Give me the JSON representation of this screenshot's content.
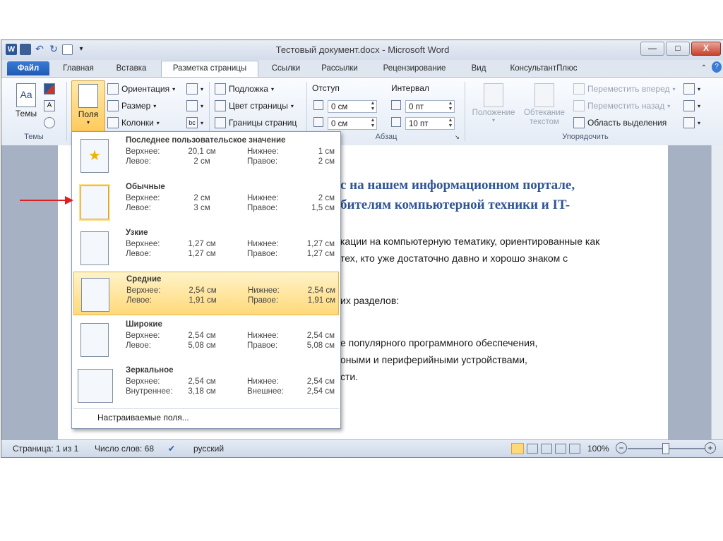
{
  "window": {
    "title": "Тестовый документ.docx - Microsoft Word",
    "app_icon": "W",
    "controls": {
      "minimize": "—",
      "maximize": "□",
      "close": "X"
    }
  },
  "tabs": [
    {
      "label": "Файл"
    },
    {
      "label": "Главная"
    },
    {
      "label": "Вставка"
    },
    {
      "label": "Разметка страницы"
    },
    {
      "label": "Ссылки"
    },
    {
      "label": "Рассылки"
    },
    {
      "label": "Рецензирование"
    },
    {
      "label": "Вид"
    },
    {
      "label": "КонсультантПлюс"
    }
  ],
  "ribbon": {
    "themes": {
      "label": "Темы",
      "group": "Темы"
    },
    "margins": {
      "label": "Поля"
    },
    "page_setup": {
      "orientation": "Ориентация",
      "size": "Размер",
      "columns": "Колонки"
    },
    "background": {
      "watermark": "Подложка",
      "page_color": "Цвет страницы",
      "page_borders": "Границы страниц"
    },
    "paragraph": {
      "group": "Абзац",
      "indent_label": "Отступ",
      "spacing_label": "Интервал",
      "indent_left": "0 см",
      "indent_right": "0 см",
      "spacing_before": "0 пт",
      "spacing_after": "10 пт"
    },
    "arrange": {
      "group": "Упорядочить",
      "position": "Положение",
      "wrap": "Обтекание текстом",
      "bring_forward": "Переместить вперед",
      "send_backward": "Переместить назад",
      "selection_pane": "Область выделения"
    }
  },
  "document": {
    "heading_line1": "с на нашем информационном портале,",
    "heading_line2": "бителям компьютерной техники и IT-",
    "lines": [
      "кации на компьютерную тематику, ориентированные как",
      "тех, кто уже достаточно давно и хорошо знаком с",
      "их разделов:",
      "е популярного программного обеспечения,",
      "оными и периферийными устройствами,",
      "сти."
    ]
  },
  "margins_menu": {
    "options": [
      {
        "title": "Последнее пользовательское значение",
        "top_label": "Верхнее:",
        "top": "20,1 см",
        "bottom_label": "Нижнее:",
        "bottom": "1 см",
        "left_label": "Левое:",
        "left": "2 см",
        "right_label": "Правое:",
        "right": "2 см"
      },
      {
        "title": "Обычные",
        "top_label": "Верхнее:",
        "top": "2 см",
        "bottom_label": "Нижнее:",
        "bottom": "2 см",
        "left_label": "Левое:",
        "left": "3 см",
        "right_label": "Правое:",
        "right": "1,5 см"
      },
      {
        "title": "Узкие",
        "top_label": "Верхнее:",
        "top": "1,27 см",
        "bottom_label": "Нижнее:",
        "bottom": "1,27 см",
        "left_label": "Левое:",
        "left": "1,27 см",
        "right_label": "Правое:",
        "right": "1,27 см"
      },
      {
        "title": "Средние",
        "top_label": "Верхнее:",
        "top": "2,54 см",
        "bottom_label": "Нижнее:",
        "bottom": "2,54 см",
        "left_label": "Левое:",
        "left": "1,91 см",
        "right_label": "Правое:",
        "right": "1,91 см"
      },
      {
        "title": "Широкие",
        "top_label": "Верхнее:",
        "top": "2,54 см",
        "bottom_label": "Нижнее:",
        "bottom": "2,54 см",
        "left_label": "Левое:",
        "left": "5,08 см",
        "right_label": "Правое:",
        "right": "5,08 см"
      },
      {
        "title": "Зеркальное",
        "top_label": "Верхнее:",
        "top": "2,54 см",
        "bottom_label": "Нижнее:",
        "bottom": "2,54 см",
        "left_label": "Внутреннее:",
        "left": "3,18 см",
        "right_label": "Внешнее:",
        "right": "2,54 см"
      }
    ],
    "custom": "Настраиваемые поля..."
  },
  "statusbar": {
    "page": "Страница: 1 из 1",
    "words": "Число слов: 68",
    "language": "русский",
    "zoom": "100%",
    "zoom_minus": "−",
    "zoom_plus": "+"
  },
  "colors": {
    "accent": "#2b5797",
    "selected": "#ffd979",
    "arrow": "#e02020"
  }
}
